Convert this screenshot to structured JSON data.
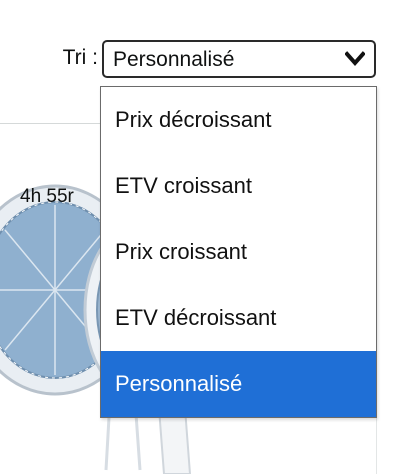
{
  "sort": {
    "label": "Tri :",
    "selected_value": "Personnalisé",
    "options": [
      {
        "label": "Prix décroissant",
        "selected": false
      },
      {
        "label": "ETV croissant",
        "selected": false
      },
      {
        "label": "Prix croissant",
        "selected": false
      },
      {
        "label": "ETV décroissant",
        "selected": false
      },
      {
        "label": "Personnalisé",
        "selected": true
      }
    ],
    "highlight_color": "#1f6fd6",
    "chevron_icon": "chevron-down-icon"
  },
  "product": {
    "timer_text": "4h 55r",
    "image_icon": "fan-product-image"
  }
}
